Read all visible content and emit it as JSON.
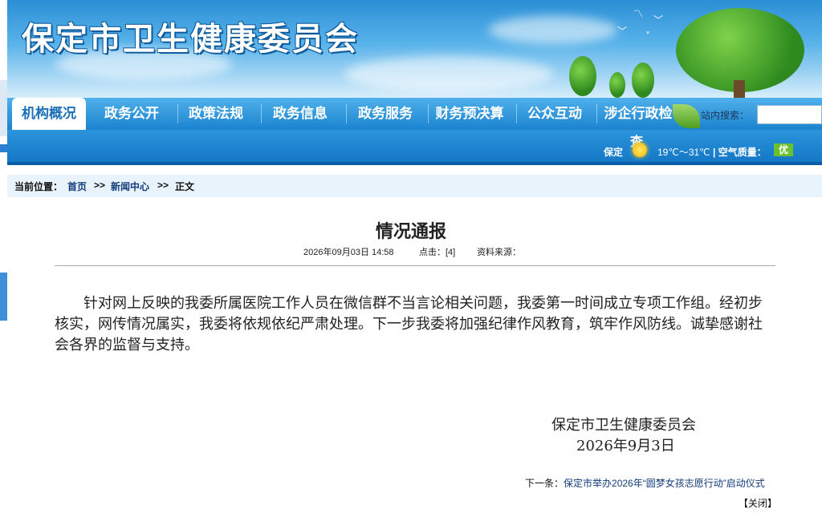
{
  "header": {
    "site_title": "保定市卫生健康委员会"
  },
  "nav": {
    "items": [
      {
        "label": "机构概况",
        "active": true
      },
      {
        "label": "政务公开"
      },
      {
        "label": "政策法规"
      },
      {
        "label": "政务信息"
      },
      {
        "label": "政务服务"
      },
      {
        "label": "财务预决算"
      },
      {
        "label": "公众互动"
      },
      {
        "label": "涉企行政检"
      }
    ],
    "search_label": "站内搜索：",
    "search_value": "",
    "search_extra_glyph": "查"
  },
  "weather": {
    "city": "保定",
    "temperature": "19℃～31℃",
    "air_quality_label": "| 空气质量：",
    "air_quality_value": "优",
    "icon": "sunny-icon"
  },
  "breadcrumb": {
    "prefix": "当前位置：",
    "home": "首页",
    "sep1": ">>",
    "section": "新闻中心",
    "sep2": ">>",
    "current": "正文"
  },
  "article": {
    "title": "情况通报",
    "datetime": "2026年09月03日 14:58",
    "clicks_label": "点击：[4]",
    "source_label": "资料来源：",
    "body": "针对网上反映的我委所属医院工作人员在微信群不当言论相关问题，我委第一时间成立专项工作组。经初步核实，网传情况属实，我委将依规依纪严肃处理。下一步我委将加强纪律作风教育，筑牢作风防线。诚挚感谢社会各界的监督与支持。",
    "sign_org": "保定市卫生健康委员会",
    "sign_date": "2026年9月3日"
  },
  "footer": {
    "next_prefix": "下一条：",
    "next_title": "保定市举办2026年“圆梦女孩志愿行动”启动仪式",
    "close_label": "【关闭】"
  },
  "colors": {
    "nav_blue": "#1b83cf",
    "link_blue": "#133c7a",
    "air_good": "#6cbf2e"
  }
}
